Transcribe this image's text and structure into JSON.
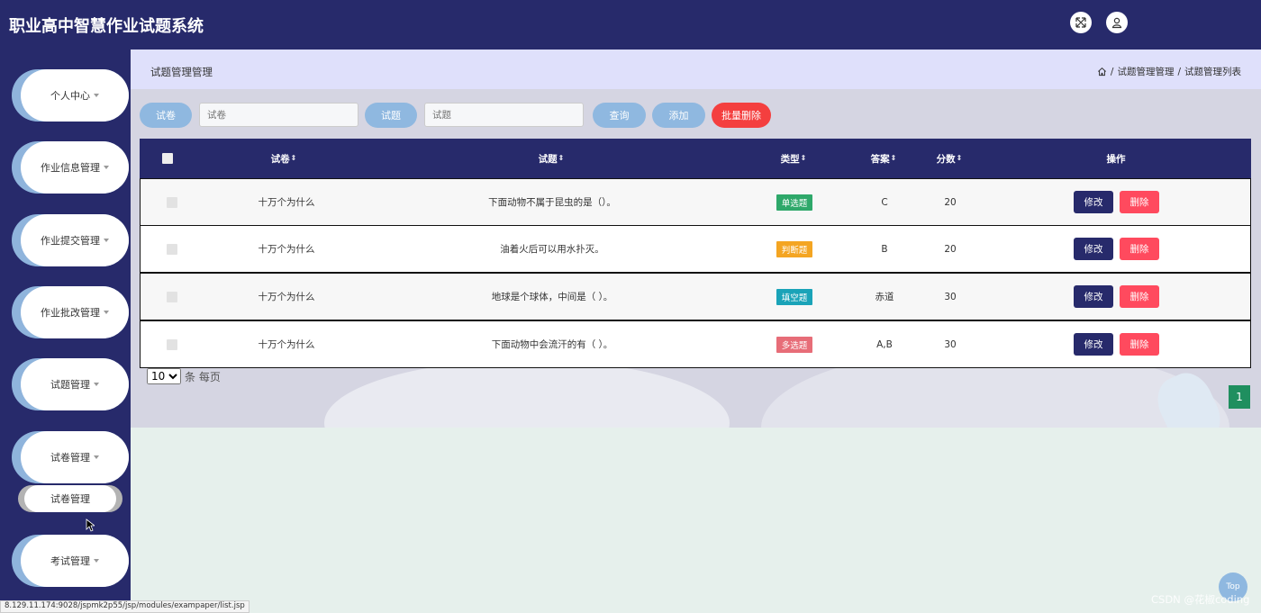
{
  "app": {
    "title": "职业高中智慧作业试题系统"
  },
  "icons": {
    "fullscreen": "expand-arrows-icon",
    "user": "user-icon",
    "home": "home-icon"
  },
  "sidebar": {
    "items": [
      {
        "label": "个人中心"
      },
      {
        "label": "作业信息管理"
      },
      {
        "label": "作业提交管理"
      },
      {
        "label": "作业批改管理"
      },
      {
        "label": "试题管理"
      },
      {
        "label": "试卷管理"
      },
      {
        "label": "考试管理"
      }
    ],
    "submenu": {
      "label": "试卷管理"
    }
  },
  "breadcrumb": {
    "title": "试题管理管理",
    "path": [
      "试题管理管理",
      "试题管理列表"
    ],
    "separator": "/"
  },
  "search": {
    "paper_label": "试卷",
    "paper_placeholder": "试卷",
    "question_label": "试题",
    "question_placeholder": "试题",
    "query_button": "查询",
    "add_button": "添加",
    "batch_delete_button": "批量删除"
  },
  "table": {
    "headers": {
      "paper": "试卷",
      "question": "试题",
      "type": "类型",
      "answer": "答案",
      "score": "分数",
      "actions": "操作"
    },
    "sort_icon": "⇕",
    "rows": [
      {
        "paper": "十万个为什么",
        "question": "下面动物不属于昆虫的是（）。",
        "type": "单选题",
        "type_color": "#2ea86a",
        "answer": "C",
        "score": "20"
      },
      {
        "paper": "十万个为什么",
        "question": "油着火后可以用水扑灭。",
        "type": "判断题",
        "type_color": "#f4a522",
        "answer": "B",
        "score": "20"
      },
      {
        "paper": "十万个为什么",
        "question": "地球是个球体，中间是（ ）。",
        "type": "填空题",
        "type_color": "#1aa3b8",
        "answer": "赤道",
        "score": "30"
      },
      {
        "paper": "十万个为什么",
        "question": "下面动物中会流汗的有（ ）。",
        "type": "多选题",
        "type_color": "#e76d78",
        "answer": "A,B",
        "score": "30"
      }
    ],
    "edit_label": "修改",
    "delete_label": "删除"
  },
  "pagination": {
    "page_size": "10",
    "page_size_options": [
      "10"
    ],
    "per_page_label": "条 每页",
    "current_page": "1"
  },
  "misc": {
    "top_button": "Top",
    "watermark": "CSDN @花椒coding",
    "status_url": "8.129.11.174:9028/jspmk2p55/jsp/modules/exampaper/list.jsp"
  },
  "colors": {
    "primary": "#272a6b",
    "pill": "#8fb8e0",
    "danger": "#f43f3f",
    "delete": "#ff4a5e",
    "page": "#1f8f5f"
  }
}
